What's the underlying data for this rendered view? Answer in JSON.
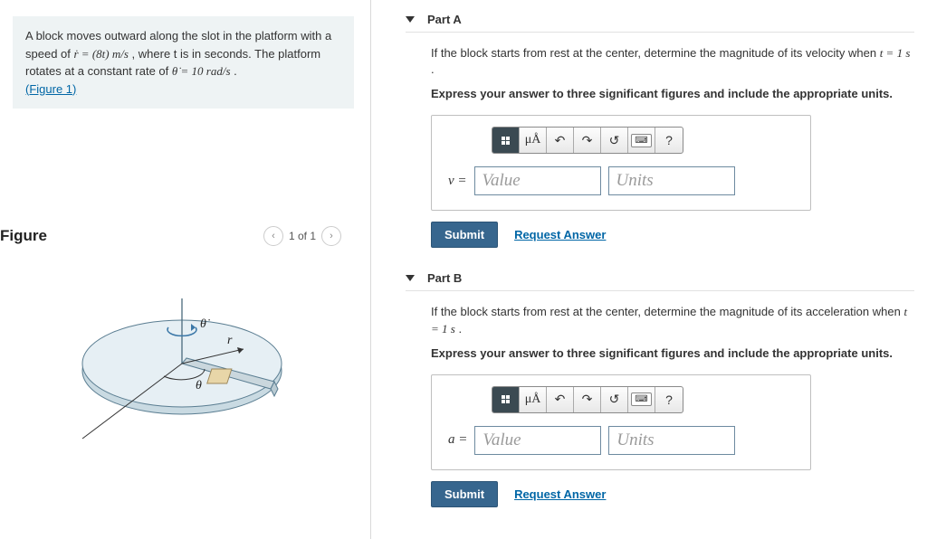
{
  "left": {
    "problem_line1_pre": "A block moves outward along the slot in the platform with a speed of ",
    "problem_line1_eq": "ṙ = (8t)  m/s",
    "problem_line1_post": ", where t is in seconds. The platform rotates at a constant rate of ",
    "problem_line2_eq": "θ̇ = 10 rad/s",
    "problem_line2_post": " .",
    "figure_link": "(Figure 1)",
    "figure_title": "Figure",
    "pager_label": "1 of 1",
    "fig_labels": {
      "thetadot": "θ̇",
      "r": "r",
      "theta": "θ"
    }
  },
  "parts": [
    {
      "title": "Part A",
      "prompt_pre": "If the block starts from rest at the center, determine the magnitude of its velocity when ",
      "prompt_eq": "t = 1 s",
      "prompt_post": ".",
      "instructions": "Express your answer to three significant figures and include the appropriate units.",
      "var_label": "v =",
      "value_placeholder": "Value",
      "units_placeholder": "Units"
    },
    {
      "title": "Part B",
      "prompt_pre": "If the block starts from rest at the center, determine the magnitude of its acceleration when ",
      "prompt_eq": "t = 1 s",
      "prompt_post": ".",
      "instructions": "Express your answer to three significant figures and include the appropriate units.",
      "var_label": "a =",
      "value_placeholder": "Value",
      "units_placeholder": "Units"
    }
  ],
  "common": {
    "submit": "Submit",
    "request_answer": "Request Answer",
    "mu_a": "μÅ",
    "question_mark": "?"
  }
}
